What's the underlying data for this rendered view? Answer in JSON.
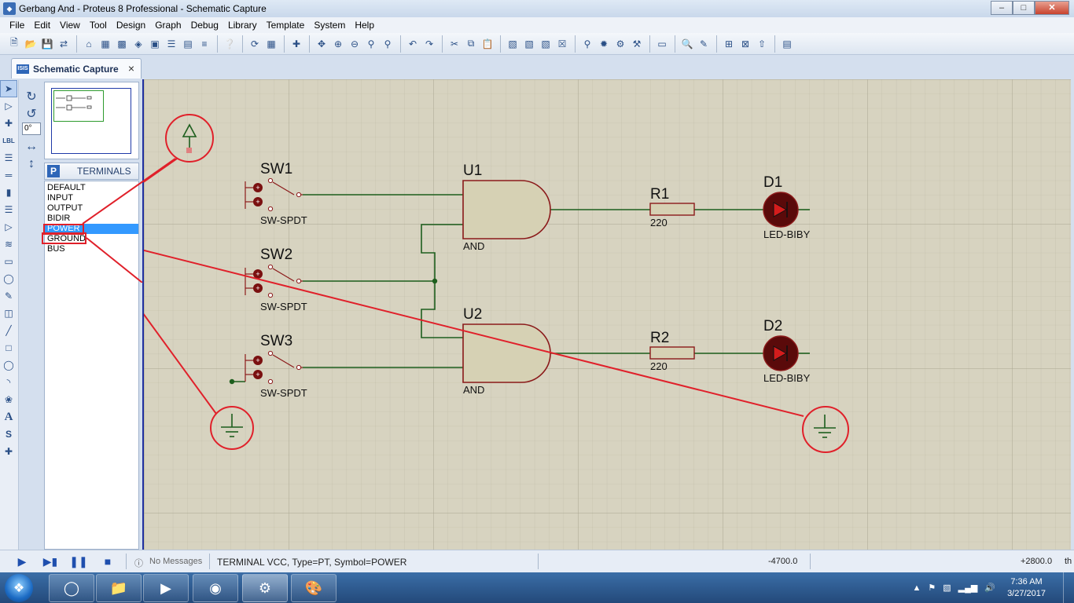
{
  "window": {
    "title": "Gerbang And - Proteus 8 Professional - Schematic Capture",
    "minimize": "–",
    "maximize": "□",
    "close": "✕"
  },
  "menu": [
    "File",
    "Edit",
    "View",
    "Tool",
    "Design",
    "Graph",
    "Debug",
    "Library",
    "Template",
    "System",
    "Help"
  ],
  "tab": {
    "label": "Schematic Capture",
    "close": "×",
    "icon_text": "ISIS"
  },
  "rotation": {
    "angle": "0°"
  },
  "terminals": {
    "badge": "P",
    "title": "TERMINALS",
    "items": [
      "DEFAULT",
      "INPUT",
      "OUTPUT",
      "BIDIR",
      "POWER",
      "GROUND",
      "BUS"
    ],
    "selected": "POWER"
  },
  "schematic": {
    "sw1": {
      "ref": "SW1",
      "type": "SW-SPDT"
    },
    "sw2": {
      "ref": "SW2",
      "type": "SW-SPDT"
    },
    "sw3": {
      "ref": "SW3",
      "type": "SW-SPDT"
    },
    "u1": {
      "ref": "U1",
      "type": "AND"
    },
    "u2": {
      "ref": "U2",
      "type": "AND"
    },
    "r1": {
      "ref": "R1",
      "value": "220"
    },
    "r2": {
      "ref": "R2",
      "value": "220"
    },
    "d1": {
      "ref": "D1",
      "type": "LED-BIBY"
    },
    "d2": {
      "ref": "D2",
      "type": "LED-BIBY"
    }
  },
  "status": {
    "messages": "No Messages",
    "info": "TERMINAL VCC, Type=PT, Symbol=POWER",
    "coord_x": "-4700.0",
    "coord_y": "+2800.0",
    "units": "th"
  },
  "taskbar": {
    "time": "7:36 AM",
    "date": "3/27/2017"
  },
  "colors": {
    "wire": "#1d5e1d",
    "component_fill": "#d6d1b4",
    "component_outline": "#8b1a1a",
    "annotation": "#e0202a",
    "canvas_bg": "#d7d3c0",
    "selection": "#3399ff"
  }
}
